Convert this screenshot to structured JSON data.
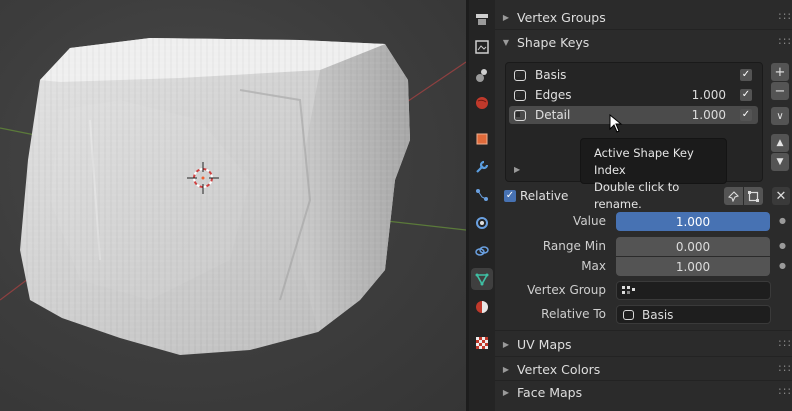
{
  "viewport": {
    "object": "cube-rock-mesh"
  },
  "tabs": [
    "tool-icon",
    "render-icon",
    "output-icon",
    "view-layer-icon",
    "scene-icon",
    "world-icon",
    "object-icon",
    "modifier-icon",
    "particles-icon",
    "physics-icon",
    "constraints-icon",
    "mesh-data-icon",
    "material-icon",
    "texture-icon"
  ],
  "panels": {
    "vertex_groups": "Vertex Groups",
    "shape_keys": "Shape Keys",
    "uv_maps": "UV Maps",
    "vertex_colors": "Vertex Colors",
    "face_maps": "Face Maps"
  },
  "shape_keys": [
    {
      "name": "Basis",
      "value": "",
      "checked": true
    },
    {
      "name": "Edges",
      "value": "1.000",
      "checked": true
    },
    {
      "name": "Detail",
      "value": "1.000",
      "checked": true,
      "selected": true
    }
  ],
  "tooltip": {
    "line1": "Active Shape Key Index",
    "line2": "Double click to rename."
  },
  "relative": {
    "label": "Relative",
    "checked": true
  },
  "fields": {
    "value_label": "Value",
    "value": "1.000",
    "range_min_label": "Range Min",
    "range_min": "0.000",
    "max_label": "Max",
    "max": "1.000",
    "vertex_group_label": "Vertex Group",
    "vertex_group": "",
    "relative_to_label": "Relative To",
    "relative_to": "Basis"
  },
  "colors": {
    "accent": "#4772b3",
    "panel": "#2b2b2b",
    "mesh_data_tab": "#3fbfa3"
  }
}
